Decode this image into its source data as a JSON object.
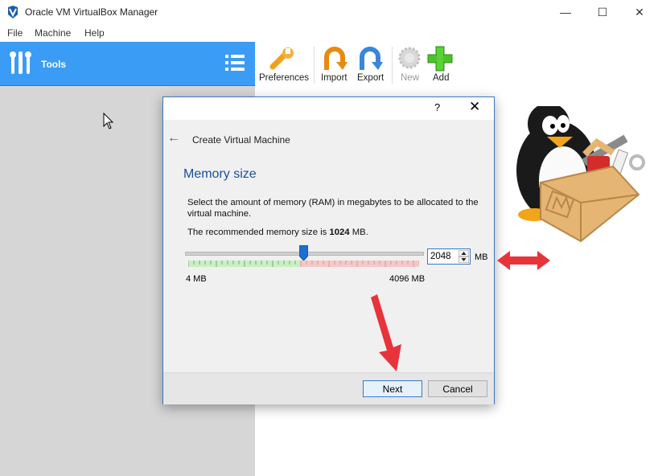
{
  "window": {
    "title": "Oracle VM VirtualBox Manager",
    "minimize": "—",
    "maximize": "☐",
    "close": "✕"
  },
  "menu": [
    "File",
    "Machine",
    "Help"
  ],
  "sidebar": {
    "tools_label": "Tools"
  },
  "toolbar": {
    "preferences": "Preferences",
    "import": "Import",
    "export": "Export",
    "new": "New",
    "add": "Add"
  },
  "dialog": {
    "help": "?",
    "close": "✕",
    "heading": "Create Virtual Machine",
    "section_title": "Memory size",
    "description": "Select the amount of memory (RAM) in megabytes to be allocated to the virtual machine.",
    "recommend_prefix": "The recommended memory size is ",
    "recommend_value": "1024",
    "recommend_suffix": " MB.",
    "slider": {
      "min_label": "4 MB",
      "max_label": "4096 MB",
      "value": 2048,
      "min": 4,
      "max": 4096
    },
    "spin_value": "2048",
    "unit": "MB",
    "next": "Next",
    "cancel": "Cancel"
  },
  "colors": {
    "accent": "#3a9cf5",
    "heading": "#1a4f9c",
    "arrow": "#e8333a"
  }
}
